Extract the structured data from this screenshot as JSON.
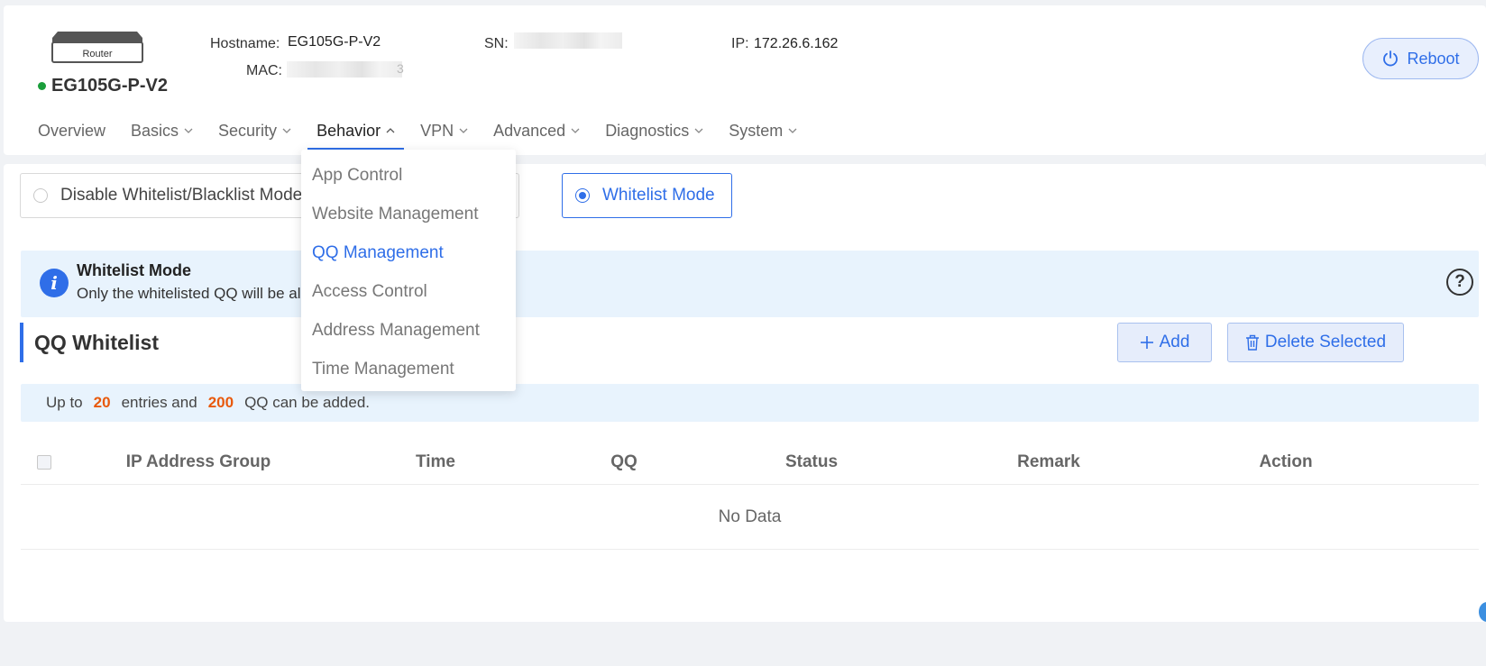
{
  "device": {
    "icon_label": "Router",
    "name": "EG105G-P-V2",
    "hostname_label": "Hostname:",
    "hostname": "EG105G-P-V2",
    "mac_label": "MAC:",
    "mac_suffix": "3",
    "sn_label": "SN:",
    "ip_label": "IP:",
    "ip": "172.26.6.162",
    "status_color": "#1a9e3b"
  },
  "header": {
    "reboot_label": "Reboot"
  },
  "nav": {
    "items": [
      {
        "label": "Overview",
        "has_menu": false
      },
      {
        "label": "Basics",
        "has_menu": true
      },
      {
        "label": "Security",
        "has_menu": true
      },
      {
        "label": "Behavior",
        "has_menu": true,
        "active": true
      },
      {
        "label": "VPN",
        "has_menu": true
      },
      {
        "label": "Advanced",
        "has_menu": true
      },
      {
        "label": "Diagnostics",
        "has_menu": true
      },
      {
        "label": "System",
        "has_menu": true
      }
    ]
  },
  "dropdown": {
    "items": [
      {
        "label": "App Control"
      },
      {
        "label": "Website Management"
      },
      {
        "label": "QQ Management",
        "active": true
      },
      {
        "label": "Access Control"
      },
      {
        "label": "Address Management"
      },
      {
        "label": "Time Management"
      }
    ]
  },
  "mode": {
    "disable_label": "Disable Whitelist/Blacklist Mode",
    "whitelist_label": "Whitelist Mode",
    "selected": "whitelist"
  },
  "alert": {
    "title": "Whitelist Mode",
    "text": "Only the whitelisted QQ will be all"
  },
  "section": {
    "title": "QQ Whitelist",
    "add_label": "Add",
    "delete_label": "Delete Selected"
  },
  "tip": {
    "prefix": "Up to",
    "entries": "20",
    "middle": "entries and",
    "qq_count": "200",
    "suffix": "QQ can be added."
  },
  "table": {
    "columns": [
      "IP Address Group",
      "Time",
      "QQ",
      "Status",
      "Remark",
      "Action"
    ],
    "empty_text": "No Data"
  },
  "colors": {
    "accent": "#2f6ee8",
    "highlight_number": "#e8590c"
  }
}
